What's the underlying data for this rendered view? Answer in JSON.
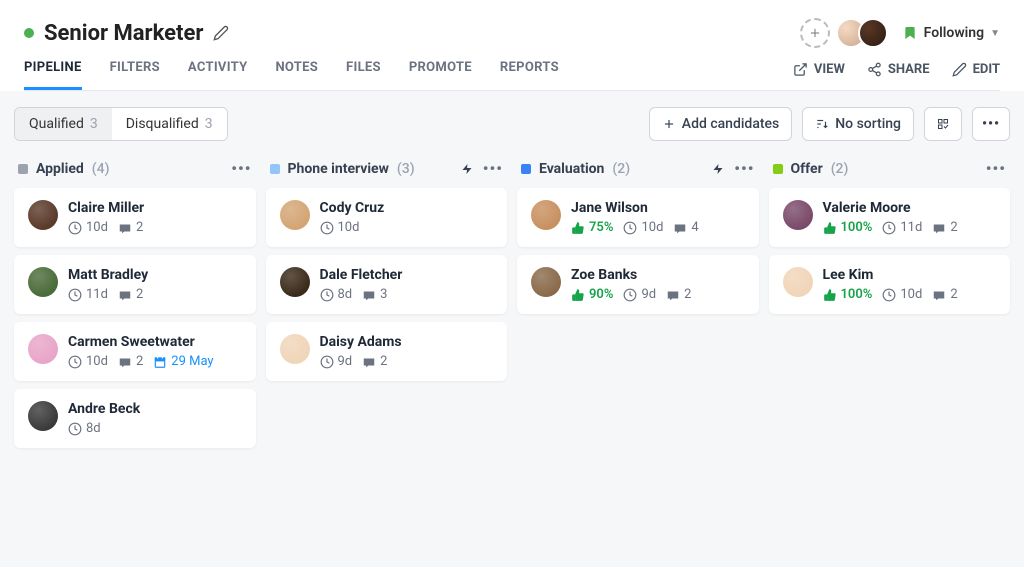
{
  "header": {
    "title": "Senior Marketer",
    "following": "Following"
  },
  "nav": {
    "tabs": [
      "PIPELINE",
      "FILTERS",
      "ACTIVITY",
      "NOTES",
      "FILES",
      "PROMOTE",
      "REPORTS"
    ],
    "actions": {
      "view": "VIEW",
      "share": "SHARE",
      "edit": "EDIT"
    }
  },
  "toolbar": {
    "segments": [
      {
        "label": "Qualified",
        "count": 3,
        "active": true
      },
      {
        "label": "Disqualified",
        "count": 3,
        "active": false
      }
    ],
    "add": "Add candidates",
    "sort": "No sorting"
  },
  "columns": [
    {
      "id": "applied",
      "title": "Applied",
      "count": 4,
      "color": "gray",
      "bolt": false
    },
    {
      "id": "phone",
      "title": "Phone interview",
      "count": 3,
      "color": "lightblue",
      "bolt": true
    },
    {
      "id": "eval",
      "title": "Evaluation",
      "count": 2,
      "color": "blue",
      "bolt": true
    },
    {
      "id": "offer",
      "title": "Offer",
      "count": 2,
      "color": "green",
      "bolt": false
    }
  ],
  "cards": {
    "applied": [
      {
        "name": "Claire Miller",
        "age": "10d",
        "comments": 2
      },
      {
        "name": "Matt Bradley",
        "age": "11d",
        "comments": 2
      },
      {
        "name": "Carmen Sweetwater",
        "age": "10d",
        "comments": 2,
        "date": "29 May"
      },
      {
        "name": "Andre Beck",
        "age": "8d"
      }
    ],
    "phone": [
      {
        "name": "Cody Cruz",
        "age": "10d"
      },
      {
        "name": "Dale Fletcher",
        "age": "8d",
        "comments": 3
      },
      {
        "name": "Daisy Adams",
        "age": "9d",
        "comments": 2
      }
    ],
    "eval": [
      {
        "name": "Jane Wilson",
        "score": "75%",
        "age": "10d",
        "comments": 4
      },
      {
        "name": "Zoe Banks",
        "score": "90%",
        "age": "9d",
        "comments": 2
      }
    ],
    "offer": [
      {
        "name": "Valerie Moore",
        "score": "100%",
        "age": "11d",
        "comments": 2
      },
      {
        "name": "Lee Kim",
        "score": "100%",
        "age": "10d",
        "comments": 2
      }
    ]
  },
  "avatar_colors": {
    "Claire Miller": "#5a3a2a",
    "Matt Bradley": "#4a6b3a",
    "Carmen Sweetwater": "#e8a5c8",
    "Andre Beck": "#3a3a3a",
    "Cody Cruz": "#d4a574",
    "Dale Fletcher": "#3a2a1a",
    "Daisy Adams": "#f0d5b8",
    "Jane Wilson": "#c89060",
    "Zoe Banks": "#8a6a4a",
    "Valerie Moore": "#7a4a6a",
    "Lee Kim": "#f0d5b8"
  }
}
